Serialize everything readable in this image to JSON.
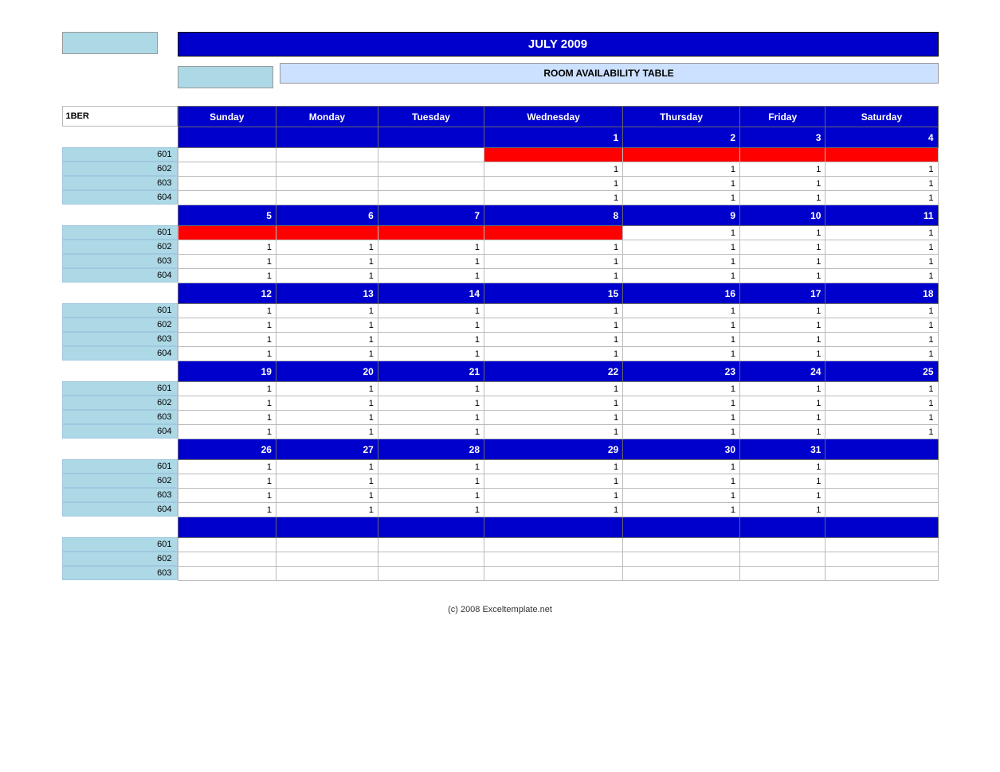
{
  "header": {
    "title": "JULY 2009",
    "subtitle": "ROOM AVAILABILITY TABLE",
    "column_label": "1BER"
  },
  "days": [
    "Sunday",
    "Monday",
    "Tuesday",
    "Wednesday",
    "Thursday",
    "Friday",
    "Saturday"
  ],
  "weeks": [
    {
      "dates": [
        "",
        "",
        "",
        "1",
        "2",
        "3",
        "4"
      ],
      "rooms": {
        "601": [
          "",
          "",
          "",
          "red",
          "red",
          "red",
          "red"
        ],
        "602": [
          "",
          "",
          "",
          "1",
          "1",
          "1",
          "1"
        ],
        "603": [
          "",
          "",
          "",
          "1",
          "1",
          "1",
          "1"
        ],
        "604": [
          "",
          "",
          "",
          "1",
          "1",
          "1",
          "1"
        ]
      }
    },
    {
      "dates": [
        "5",
        "6",
        "7",
        "8",
        "9",
        "10",
        "11"
      ],
      "rooms": {
        "601": [
          "red",
          "red",
          "red",
          "red",
          "1",
          "1",
          "1"
        ],
        "602": [
          "1",
          "1",
          "1",
          "1",
          "1",
          "1",
          "1"
        ],
        "603": [
          "1",
          "1",
          "1",
          "1",
          "1",
          "1",
          "1"
        ],
        "604": [
          "1",
          "1",
          "1",
          "1",
          "1",
          "1",
          "1"
        ]
      }
    },
    {
      "dates": [
        "12",
        "13",
        "14",
        "15",
        "16",
        "17",
        "18"
      ],
      "rooms": {
        "601": [
          "1",
          "1",
          "1",
          "1",
          "1",
          "1",
          "1"
        ],
        "602": [
          "1",
          "1",
          "1",
          "1",
          "1",
          "1",
          "1"
        ],
        "603": [
          "1",
          "1",
          "1",
          "1",
          "1",
          "1",
          "1"
        ],
        "604": [
          "1",
          "1",
          "1",
          "1",
          "1",
          "1",
          "1"
        ]
      }
    },
    {
      "dates": [
        "19",
        "20",
        "21",
        "22",
        "23",
        "24",
        "25"
      ],
      "rooms": {
        "601": [
          "1",
          "1",
          "1",
          "1",
          "1",
          "1",
          "1"
        ],
        "602": [
          "1",
          "1",
          "1",
          "1",
          "1",
          "1",
          "1"
        ],
        "603": [
          "1",
          "1",
          "1",
          "1",
          "1",
          "1",
          "1"
        ],
        "604": [
          "1",
          "1",
          "1",
          "1",
          "1",
          "1",
          "1"
        ]
      }
    },
    {
      "dates": [
        "26",
        "27",
        "28",
        "29",
        "30",
        "31",
        ""
      ],
      "rooms": {
        "601": [
          "1",
          "1",
          "1",
          "1",
          "1",
          "1",
          ""
        ],
        "602": [
          "1",
          "1",
          "1",
          "1",
          "1",
          "1",
          ""
        ],
        "603": [
          "1",
          "1",
          "1",
          "1",
          "1",
          "1",
          ""
        ],
        "604": [
          "1",
          "1",
          "1",
          "1",
          "1",
          "1",
          ""
        ]
      }
    }
  ],
  "extra_rooms": [
    "601",
    "602",
    "603"
  ],
  "footer": "(c) 2008 Exceltemplate.net",
  "room_list": [
    "601",
    "602",
    "603",
    "604"
  ]
}
